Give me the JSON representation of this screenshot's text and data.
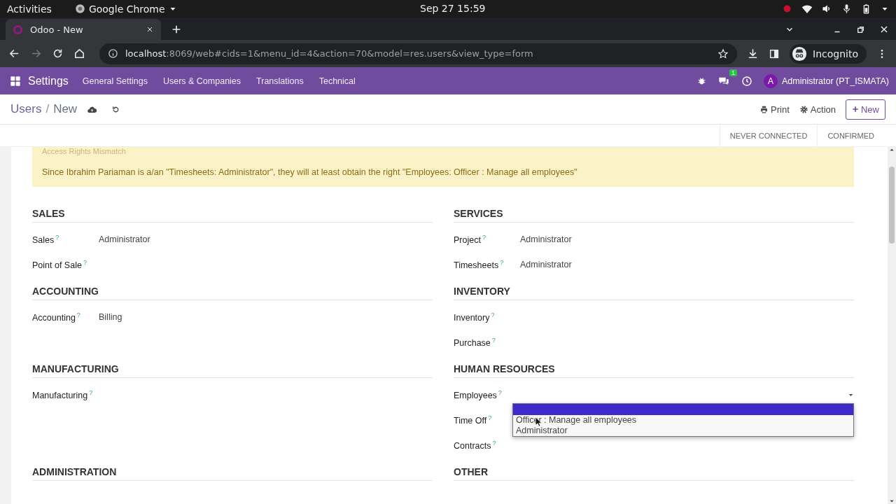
{
  "system_bar": {
    "activities": "Activities",
    "app": "Google Chrome",
    "date": "Sep 27",
    "time": "15:59"
  },
  "browser": {
    "tab_title": "Odoo - New",
    "forward_disabled": true,
    "url_host": "localhost",
    "url_rest": ":8069/web#cids=1&menu_id=4&action=70&model=res.users&view_type=form",
    "profile": "Incognito"
  },
  "navbar": {
    "app": "Settings",
    "menus": [
      "General Settings",
      "Users & Companies",
      "Translations",
      "Technical"
    ],
    "chat_count": "1",
    "avatar": "A",
    "user": "Administrator (PT_ISMATA)"
  },
  "control_panel": {
    "separator": "/",
    "breadcrumb": [
      {
        "label": "Users",
        "kind": "link"
      },
      {
        "label": "New",
        "kind": "current"
      }
    ],
    "actions": [
      {
        "label": "Print",
        "kind": "print"
      },
      {
        "label": "Action",
        "kind": "gear"
      }
    ],
    "new_button": "New"
  },
  "statusbar": [
    {
      "label": "NEVER CONNECTED",
      "selected": false
    },
    {
      "label": "CONFIRMED",
      "selected": false
    }
  ],
  "alert": {
    "title": "Access Rights Mismatch",
    "message": "Since Ibrahim Pariaman is a/an \"Timesheets: Administrator\", they will at least obtain the right \"Employees: Officer : Manage all employees\""
  },
  "section_rows": [
    [
      {
        "title": "SALES",
        "fields": [
          {
            "label": "Sales",
            "help": "?",
            "kind": "text",
            "value": "Administrator"
          },
          {
            "label": "Point of Sale",
            "help": "?",
            "kind": "text"
          }
        ]
      },
      {
        "title": "SERVICES",
        "fields": [
          {
            "label": "Project",
            "help": "?",
            "kind": "text",
            "value": "Administrator"
          },
          {
            "label": "Timesheets",
            "help": "?",
            "kind": "text",
            "value": "Administrator"
          }
        ]
      }
    ],
    [
      {
        "title": "ACCOUNTING",
        "fields": [
          {
            "label": "Accounting",
            "help": "?",
            "kind": "text",
            "value": "Billing"
          }
        ]
      },
      {
        "title": "INVENTORY",
        "fields": [
          {
            "label": "Inventory",
            "help": "?",
            "kind": "text"
          },
          {
            "label": "Purchase",
            "help": "?",
            "kind": "text"
          }
        ]
      }
    ],
    [
      {
        "title": "MANUFACTURING",
        "fields": [
          {
            "label": "Manufacturing",
            "help": "?",
            "kind": "text"
          }
        ]
      },
      {
        "title": "HUMAN RESOURCES",
        "fields": [
          {
            "label": "Employees",
            "help": "?",
            "kind": "select",
            "dropdown": {
              "open": true,
              "blank_highlighted": true,
              "options": [
                "Officer : Manage all employees",
                "Administrator"
              ]
            }
          },
          {
            "label": "Time Off",
            "help": "?",
            "kind": "text"
          },
          {
            "label": "Contracts",
            "help": "?",
            "kind": "text"
          }
        ]
      }
    ],
    [
      {
        "title": "ADMINISTRATION"
      },
      {
        "title": "OTHER"
      }
    ]
  ]
}
